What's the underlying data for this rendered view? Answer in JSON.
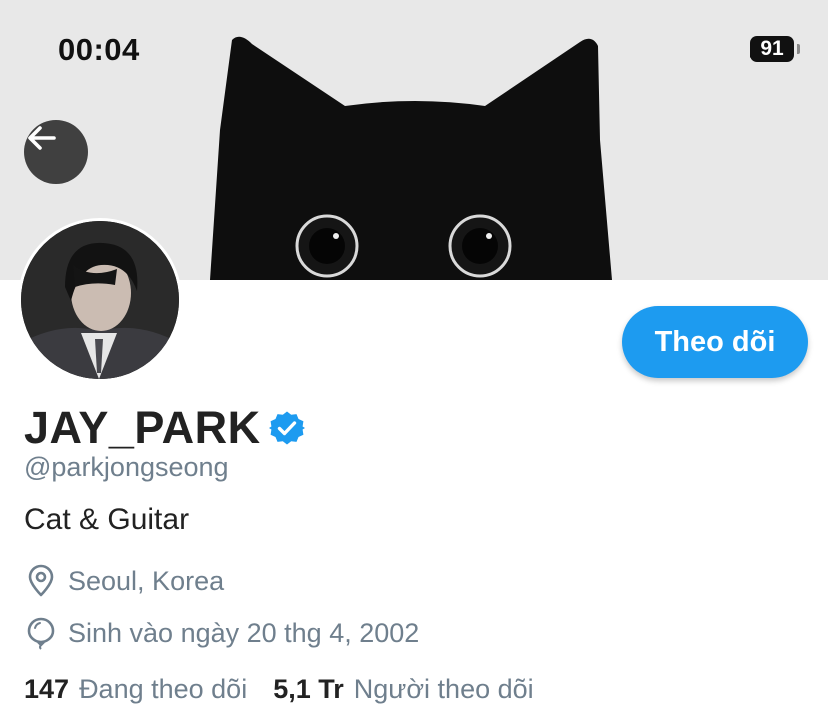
{
  "status_bar": {
    "time": "00:04",
    "battery": "91"
  },
  "header": {
    "back_icon": "arrow-left-icon"
  },
  "profile": {
    "display_name": "JAY_PARK",
    "verified_icon": "verified-badge-icon",
    "handle": "@parkjongseong",
    "bio": "Cat & Guitar",
    "location": "Seoul, Korea",
    "location_icon": "map-pin-icon",
    "birthday": "Sinh vào ngày 20 thg 4, 2002",
    "birthday_icon": "balloon-icon",
    "follow_label": "Theo dõi"
  },
  "stats": {
    "following_count": "147",
    "following_label": "Đang theo dõi",
    "followers_count": "5,1 Tr",
    "followers_label": "Người theo dõi"
  },
  "colors": {
    "accent": "#1d9bf0",
    "secondary_text": "#6f7f8d"
  }
}
